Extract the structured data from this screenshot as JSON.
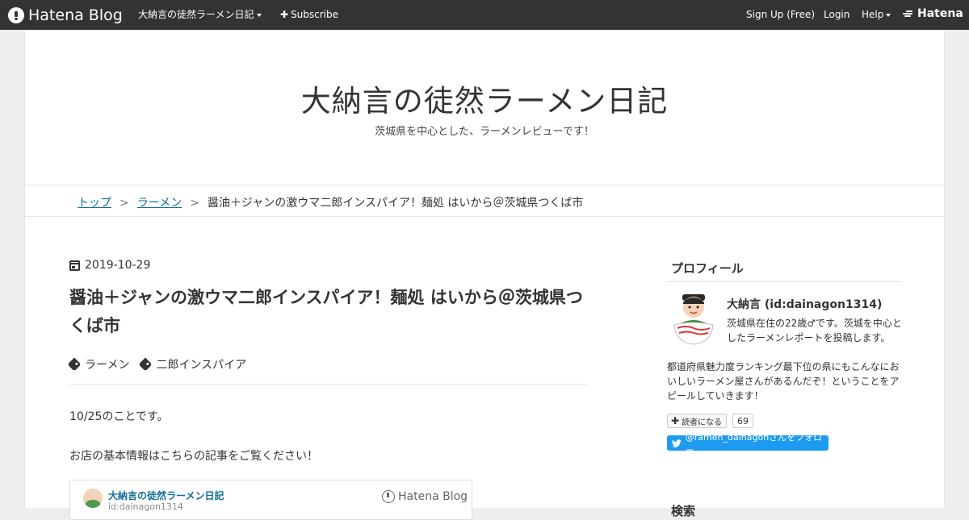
{
  "topbar": {
    "logo_text": "Hatena Blog",
    "blog_menu_label": "大納言の徒然ラーメン日記",
    "subscribe_label": "Subscribe",
    "signup_label": "Sign Up (Free)",
    "login_label": "Login",
    "help_label": "Help",
    "hatena_label": "Hatena"
  },
  "header": {
    "title": "大納言の徒然ラーメン日記",
    "description": "茨城県を中心とした、ラーメンレビューです！"
  },
  "breadcrumb": {
    "items": [
      "トップ",
      "ラーメン"
    ],
    "separator": ">",
    "current": "醤油＋ジャンの激ウマ二郎インスパイア！麺処 はいから＠茨城県つくば市"
  },
  "entry": {
    "date": "2019-10-29",
    "title": "醤油＋ジャンの激ウマ二郎インスパイア！麺処 はいから＠茨城県つくば市",
    "tags": [
      "ラーメン",
      "二郎インスパイア"
    ],
    "paragraphs": [
      "10/25のことです。",
      "お店の基本情報はこちらの記事をご覧ください！"
    ],
    "embed": {
      "title": "大納言の徒然ラーメン日記",
      "id": "id:dainagon1314",
      "brand": "Hatena Blog"
    }
  },
  "sidebar": {
    "profile_heading": "プロフィール",
    "name": "大納言 (id:dainagon1314)",
    "short_text": "茨城県在住の22歳♂です。茨城を中心としたラーメンレポートを投稿します。",
    "long_text": "都道府県魅力度ランキング最下位の県にもこんなにおいしいラーメン屋さんがあるんだぞ！ということをアピールしていきます！",
    "subscribe_label": "読者になる",
    "subscriber_count": "69",
    "twitter_label": "@ramen_dainagonさんをフォロー",
    "search_heading": "検索"
  },
  "colors": {
    "topbar_bg": "#333333",
    "link": "#0f6d99",
    "twitter": "#1d9bf0"
  }
}
